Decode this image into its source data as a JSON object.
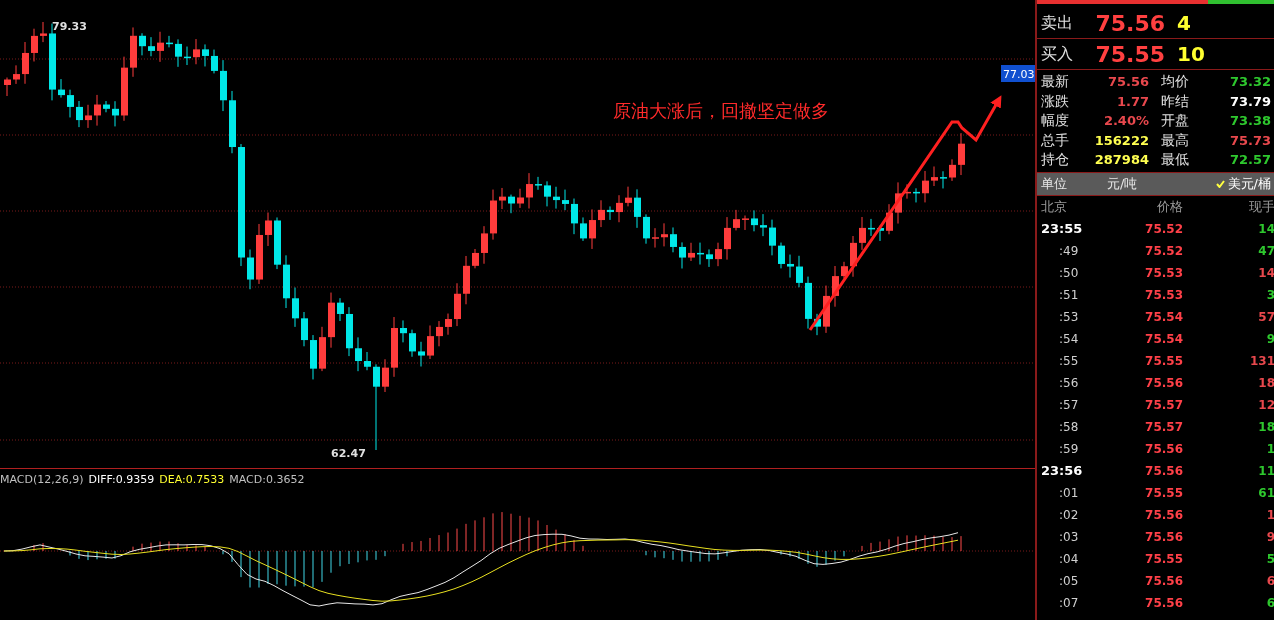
{
  "chart": {
    "high_label": "79.33",
    "low_label": "62.47",
    "price_tag": "77.03",
    "annotation": "原油大涨后，回撤坚定做多"
  },
  "macd": {
    "name": "MACD(12,26,9)",
    "diff": "DIFF:0.9359",
    "dea": "DEA:0.7533",
    "macd": "MACD:0.3652"
  },
  "quote": {
    "bid_ask_bar": {
      "level": 0.72
    },
    "orders": [
      {
        "label": "卖出",
        "price": "75.56",
        "volume": "4"
      },
      {
        "label": "买入",
        "price": "75.55",
        "volume": "10"
      }
    ],
    "stats": [
      {
        "label": "最新",
        "value": "75.56",
        "color": "#e8484d"
      },
      {
        "label": "均价",
        "value": "73.32",
        "color": "#2ec82e"
      },
      {
        "label": "涨跌",
        "value": "1.77",
        "color": "#e8484d"
      },
      {
        "label": "昨结",
        "value": "73.79",
        "color": "#ffffff"
      },
      {
        "label": "幅度",
        "value": "2.40%",
        "color": "#e8484d"
      },
      {
        "label": "开盘",
        "value": "73.38",
        "color": "#2ec82e"
      },
      {
        "label": "总手",
        "value": "156222",
        "color": "#ffff50"
      },
      {
        "label": "最高",
        "value": "75.73",
        "color": "#e8484d"
      },
      {
        "label": "持仓",
        "value": "287984",
        "color": "#ffff50"
      },
      {
        "label": "最低",
        "value": "72.57",
        "color": "#2ec82e"
      }
    ],
    "unit": {
      "label": "单位",
      "options": [
        {
          "label": "元/吨",
          "selected": false
        },
        {
          "label": "美元/桶",
          "selected": true
        }
      ]
    }
  },
  "ticks": {
    "columns": [
      "北京",
      "价格",
      "现手"
    ],
    "rows": [
      {
        "time": "23:55",
        "kind": "minute",
        "price": "75.52",
        "volume": "14",
        "color": "#2ec82e"
      },
      {
        "time": ":49",
        "kind": "second",
        "price": "75.52",
        "volume": "47",
        "color": "#2ec82e"
      },
      {
        "time": ":50",
        "kind": "second",
        "price": "75.53",
        "volume": "14",
        "color": "#e8484d"
      },
      {
        "time": ":51",
        "kind": "second",
        "price": "75.53",
        "volume": "3",
        "color": "#2ec82e"
      },
      {
        "time": ":53",
        "kind": "second",
        "price": "75.54",
        "volume": "57",
        "color": "#e8484d"
      },
      {
        "time": ":54",
        "kind": "second",
        "price": "75.54",
        "volume": "9",
        "color": "#2ec82e"
      },
      {
        "time": ":55",
        "kind": "second",
        "price": "75.55",
        "volume": "131",
        "color": "#e8484d"
      },
      {
        "time": ":56",
        "kind": "second",
        "price": "75.56",
        "volume": "18",
        "color": "#e8484d"
      },
      {
        "time": ":57",
        "kind": "second",
        "price": "75.57",
        "volume": "12",
        "color": "#e8484d"
      },
      {
        "time": ":58",
        "kind": "second",
        "price": "75.57",
        "volume": "18",
        "color": "#2ec82e"
      },
      {
        "time": ":59",
        "kind": "second",
        "price": "75.56",
        "volume": "1",
        "color": "#2ec82e"
      },
      {
        "time": "23:56",
        "kind": "minute",
        "price": "75.56",
        "volume": "11",
        "color": "#2ec82e"
      },
      {
        "time": ":01",
        "kind": "second",
        "price": "75.55",
        "volume": "61",
        "color": "#2ec82e"
      },
      {
        "time": ":02",
        "kind": "second",
        "price": "75.56",
        "volume": "1",
        "color": "#e8484d"
      },
      {
        "time": ":03",
        "kind": "second",
        "price": "75.56",
        "volume": "9",
        "color": "#e8484d"
      },
      {
        "time": ":04",
        "kind": "second",
        "price": "75.55",
        "volume": "5",
        "color": "#2ec82e"
      },
      {
        "time": ":05",
        "kind": "second",
        "price": "75.56",
        "volume": "6",
        "color": "#e8484d"
      },
      {
        "time": ":07",
        "kind": "second",
        "price": "75.56",
        "volume": "6",
        "color": "#2ec82e"
      }
    ]
  }
}
